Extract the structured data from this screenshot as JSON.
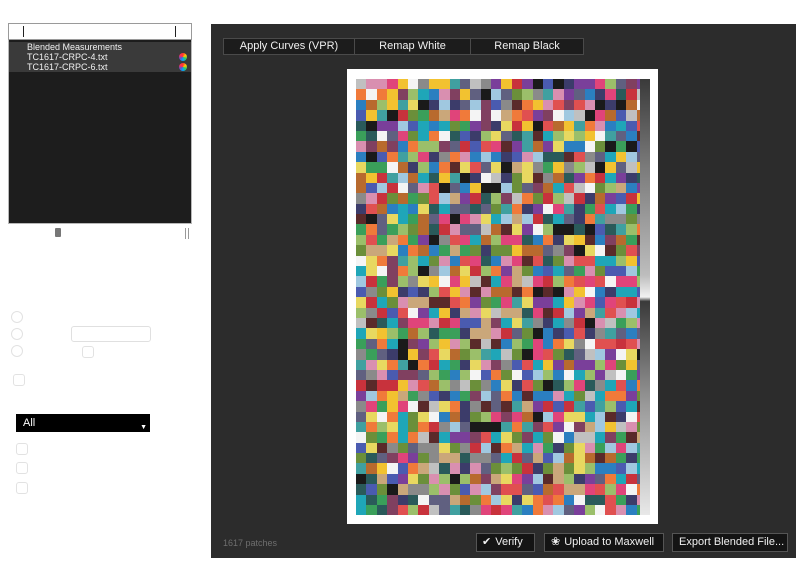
{
  "blend_list": {
    "items": [
      {
        "label": "Blended Measurements",
        "has_dot": false
      },
      {
        "label": "TC1617-CRPC-4.txt",
        "has_dot": true
      },
      {
        "label": "TC1617-CRPC-6.txt",
        "has_dot": true
      }
    ]
  },
  "filter": {
    "selected": "All"
  },
  "toolbar": {
    "apply_curves_label": "Apply Curves (VPR)",
    "remap_white_label": "Remap White",
    "remap_black_label": "Remap Black"
  },
  "status": {
    "patch_count": "1617 patches"
  },
  "actions": {
    "verify_label": "Verify",
    "upload_label": "Upload to Maxwell",
    "export_label": "Export Blended File..."
  },
  "icons": {
    "verify": "checkmark-icon",
    "upload": "fan-icon",
    "blend_dot": "color-wheel-icon"
  },
  "colors": {
    "panel_bg": "#2c2c2c",
    "list_bg": "#1d1d1d",
    "selection": "#3a3a3a"
  }
}
